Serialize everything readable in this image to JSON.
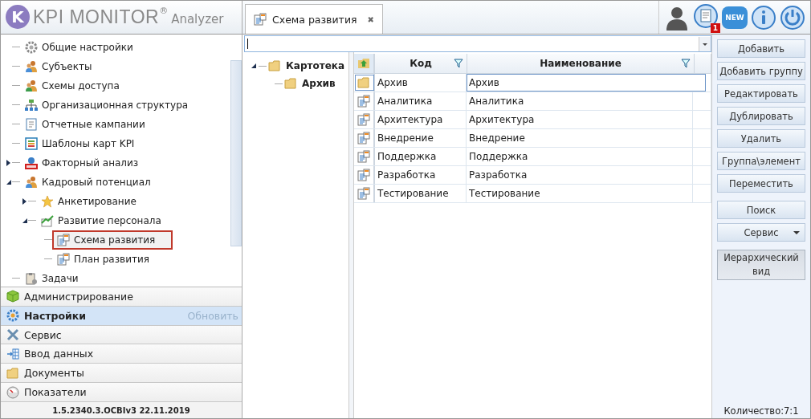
{
  "logo": {
    "mark": "K",
    "name": "KPI MONITOR",
    "registered": "®",
    "edition": "Analyzer"
  },
  "tab": {
    "label": "Схема развития",
    "close": "✖",
    "selected": true
  },
  "header_icons": {
    "notification_count": "1",
    "new_label": "NEW"
  },
  "nav_tree": [
    {
      "label": "Общие настройки",
      "selected": false
    },
    {
      "label": "Субъекты",
      "selected": false
    },
    {
      "label": "Схемы доступа",
      "selected": false
    },
    {
      "label": "Организационная структура",
      "selected": false
    },
    {
      "label": "Отчетные кампании",
      "selected": false
    },
    {
      "label": "Шаблоны карт KPI",
      "selected": false
    },
    {
      "label": "Факторный анализ",
      "selected": false,
      "expanded": false
    },
    {
      "label": "Кадровый потенциал",
      "selected": false,
      "expanded": true,
      "children": [
        {
          "label": "Анкетирование",
          "selected": false,
          "expanded": false
        },
        {
          "label": "Развитие персонала",
          "selected": false,
          "expanded": true,
          "children": [
            {
              "label": "Схема развития",
              "selected": true
            },
            {
              "label": "План развития",
              "selected": false
            }
          ]
        }
      ]
    },
    {
      "label": "Задачи",
      "selected": false
    }
  ],
  "sections": [
    {
      "label": "Администрирование",
      "selected": false
    },
    {
      "label": "Настройки",
      "selected": true,
      "action": "Обновить"
    },
    {
      "label": "Сервис",
      "selected": false
    },
    {
      "label": "Ввод данных",
      "selected": false
    },
    {
      "label": "Документы",
      "selected": false
    },
    {
      "label": "Показатели",
      "selected": false
    }
  ],
  "version": "1.5.2340.3.OCBIv3  22.11.2019",
  "folder_tree": [
    {
      "label": "Картотека",
      "expanded": true,
      "children": [
        {
          "label": "Архив"
        }
      ]
    }
  ],
  "grid": {
    "columns": [
      {
        "label": "Код",
        "filter": true
      },
      {
        "label": "Наименование",
        "filter": true
      }
    ],
    "rows": [
      {
        "kind": "folder",
        "code": "Архив",
        "name": "Архив",
        "selected": true
      },
      {
        "kind": "item",
        "code": "Аналитика",
        "name": "Аналитика",
        "selected": false
      },
      {
        "kind": "item",
        "code": "Архитектура",
        "name": "Архитектура",
        "selected": false
      },
      {
        "kind": "item",
        "code": "Внедрение",
        "name": "Внедрение",
        "selected": false
      },
      {
        "kind": "item",
        "code": "Поддержка",
        "name": "Поддержка",
        "selected": false
      },
      {
        "kind": "item",
        "code": "Разработка",
        "name": "Разработка",
        "selected": false
      },
      {
        "kind": "item",
        "code": "Тестирование",
        "name": "Тестирование",
        "selected": false
      }
    ]
  },
  "actions": [
    {
      "label": "Добавить",
      "kind": "button"
    },
    {
      "label": "Добавить группу",
      "kind": "button"
    },
    {
      "label": "Редактировать",
      "kind": "button"
    },
    {
      "label": "Дублировать",
      "kind": "button"
    },
    {
      "label": "Удалить",
      "kind": "button"
    },
    {
      "label": "Группа\\элемент",
      "kind": "button"
    },
    {
      "label": "Переместить",
      "kind": "button"
    }
  ],
  "tools": [
    {
      "label": "Поиск",
      "kind": "button"
    },
    {
      "label": "Сервис",
      "kind": "dropdown"
    }
  ],
  "view_toggle": {
    "label": "Иерархический вид",
    "on": true
  },
  "count": "Количество:7:1"
}
